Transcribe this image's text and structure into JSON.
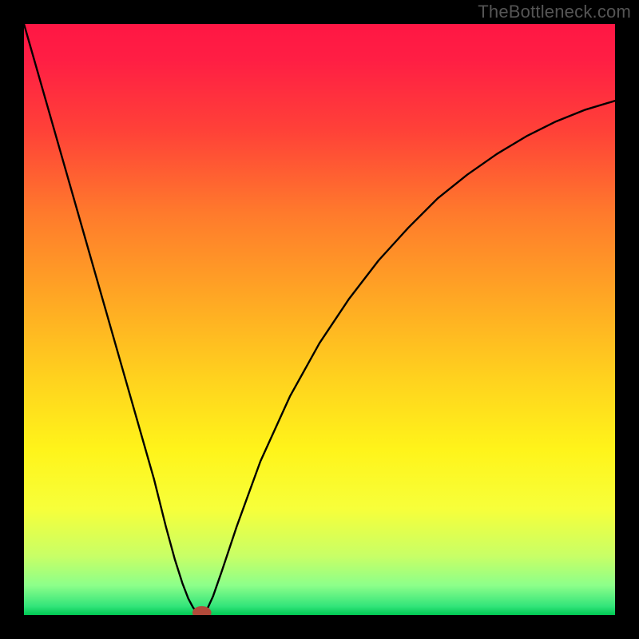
{
  "watermark": "TheBottleneck.com",
  "chart_data": {
    "type": "line",
    "title": "",
    "xlabel": "",
    "ylabel": "",
    "xlim": [
      0,
      100
    ],
    "ylim": [
      0,
      100
    ],
    "grid": false,
    "background_gradient": {
      "stops": [
        {
          "offset": 0.0,
          "color": "#ff1744"
        },
        {
          "offset": 0.06,
          "color": "#ff1e44"
        },
        {
          "offset": 0.18,
          "color": "#ff4138"
        },
        {
          "offset": 0.32,
          "color": "#ff7a2c"
        },
        {
          "offset": 0.46,
          "color": "#ffa624"
        },
        {
          "offset": 0.6,
          "color": "#ffd21e"
        },
        {
          "offset": 0.72,
          "color": "#fff41a"
        },
        {
          "offset": 0.82,
          "color": "#f7ff3a"
        },
        {
          "offset": 0.9,
          "color": "#c8ff66"
        },
        {
          "offset": 0.95,
          "color": "#8cff8a"
        },
        {
          "offset": 0.985,
          "color": "#33e57a"
        },
        {
          "offset": 1.0,
          "color": "#00c853"
        }
      ]
    },
    "series": [
      {
        "name": "left-branch",
        "stroke": "#000000",
        "stroke_width": 2.4,
        "x": [
          0,
          2,
          4,
          6,
          8,
          10,
          12,
          14,
          16,
          18,
          20,
          22,
          24,
          25.5,
          26.8,
          27.8,
          28.6,
          29.2,
          29.6,
          29.9,
          30.1
        ],
        "y": [
          100,
          93,
          86,
          79,
          72,
          65,
          58,
          51,
          44,
          37,
          30,
          23,
          15,
          9.5,
          5.4,
          2.8,
          1.3,
          0.5,
          0.15,
          0.03,
          0.0
        ]
      },
      {
        "name": "right-branch",
        "stroke": "#000000",
        "stroke_width": 2.4,
        "x": [
          30.1,
          30.4,
          31.0,
          32.0,
          33.5,
          36,
          40,
          45,
          50,
          55,
          60,
          65,
          70,
          75,
          80,
          85,
          90,
          95,
          100
        ],
        "y": [
          0.0,
          0.2,
          1.0,
          3.2,
          7.5,
          15,
          26,
          37,
          46,
          53.5,
          60,
          65.5,
          70.5,
          74.5,
          78,
          81,
          83.5,
          85.5,
          87
        ]
      }
    ],
    "marker": {
      "name": "min-marker",
      "x": 30.1,
      "y": 0.4,
      "rx": 1.6,
      "ry": 1.1,
      "fill": "#b24a3a"
    }
  }
}
